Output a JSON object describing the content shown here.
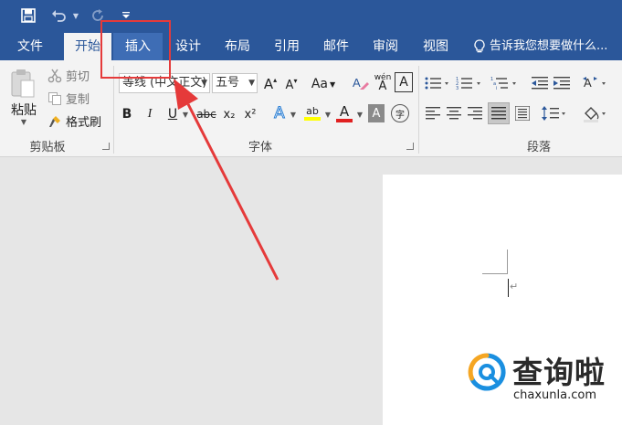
{
  "tabs": [
    {
      "label": "文件"
    },
    {
      "label": "开始"
    },
    {
      "label": "插入"
    },
    {
      "label": "设计"
    },
    {
      "label": "布局"
    },
    {
      "label": "引用"
    },
    {
      "label": "邮件"
    },
    {
      "label": "审阅"
    },
    {
      "label": "视图"
    }
  ],
  "tell_me": "告诉我您想要做什么...",
  "clipboard": {
    "paste": "粘贴",
    "cut": "剪切",
    "copy": "复制",
    "format_painter": "格式刷",
    "group_label": "剪贴板"
  },
  "font": {
    "font_name": "等线 (中文正文)",
    "font_size": "五号",
    "bold": "B",
    "italic": "I",
    "underline": "U",
    "strikethrough": "abc",
    "subscript": "x₂",
    "superscript": "x²",
    "grow": "A",
    "shrink": "A",
    "change_case": "Aa",
    "phonetic": "wén",
    "phonetic_base": "A",
    "char_border": "A",
    "text_effects": "A",
    "highlight": "ab",
    "font_color": "A",
    "char_shading": "A",
    "enclose": "字",
    "group_label": "字体"
  },
  "paragraph": {
    "group_label": "段落"
  },
  "colors": {
    "accent": "#2b579a",
    "annotation": "#e53a3a",
    "highlight_yellow": "#ffff00",
    "font_red": "#e02020"
  },
  "watermark": {
    "text": "查询啦",
    "url": "chaxunla.com"
  }
}
